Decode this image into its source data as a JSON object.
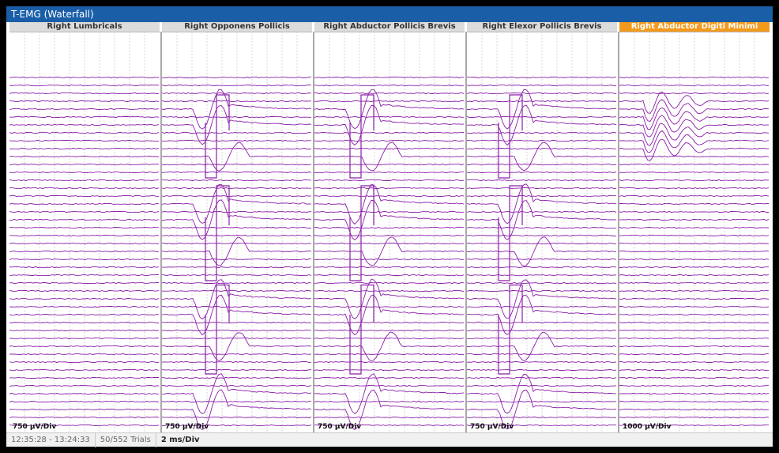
{
  "window": {
    "title": "T-EMG (Waterfall)"
  },
  "panels": [
    {
      "label": "Right Lumbricals",
      "scale": "750 µV/Div",
      "active": false
    },
    {
      "label": "Right Opponens Pollicis",
      "scale": "750 µV/Div",
      "active": false
    },
    {
      "label": "Right Abductor Pollicis Brevis",
      "scale": "750 µV/Div",
      "active": false
    },
    {
      "label": "Right Elexor Pollicis Brevis",
      "scale": "750 µV/Div",
      "active": false
    },
    {
      "label": "Right Abductor Digiti Minimi",
      "scale": "1000 µV/Div",
      "active": true
    }
  ],
  "status": {
    "time_range": "12:35:28 - 13:24:33",
    "trials": "50/552 Trials",
    "timebase": "2 ms/Div"
  },
  "colors": {
    "title_bar": "#1a5ea8",
    "trace": "#8b1fa8",
    "active_header": "#f39a1c",
    "grid": "#bdbdbd"
  }
}
